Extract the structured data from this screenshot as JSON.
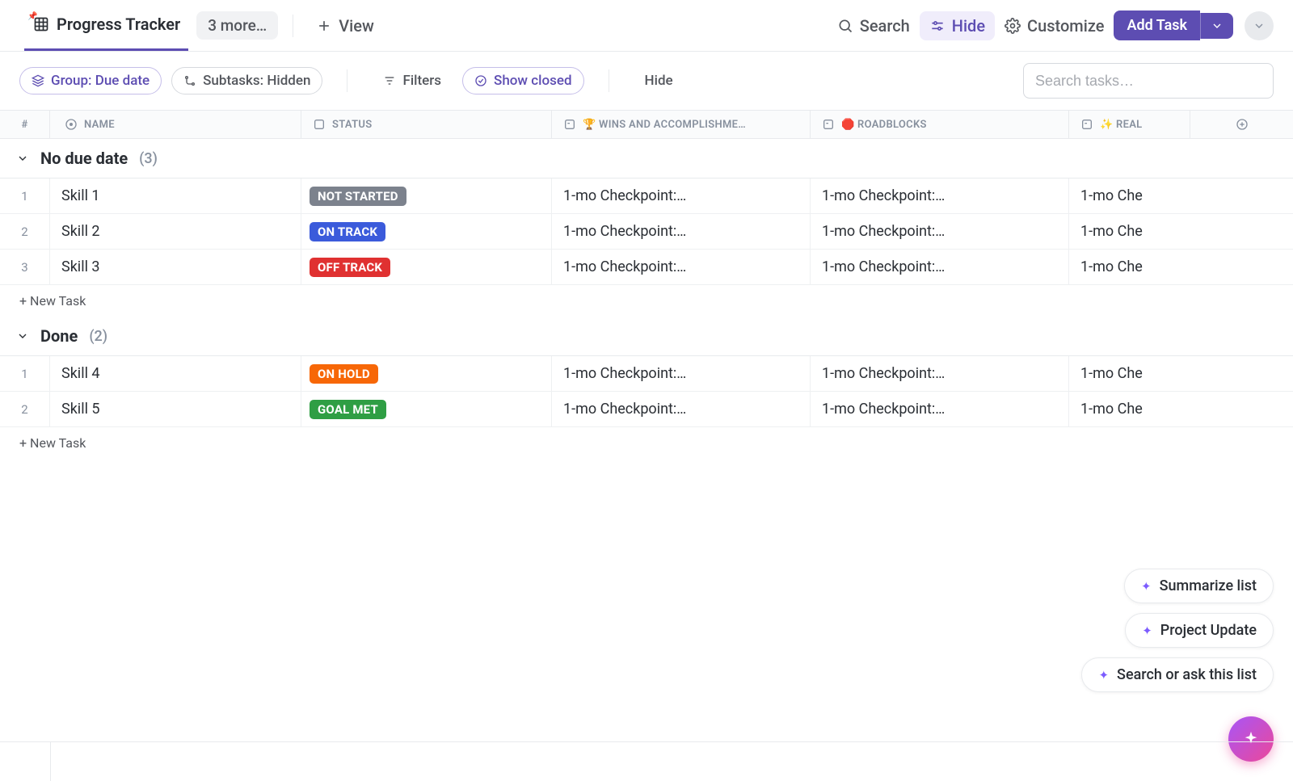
{
  "header": {
    "view_name": "Progress Tracker",
    "more_label": "3 more…",
    "add_view_label": "View",
    "search_label": "Search",
    "hide_label": "Hide",
    "customize_label": "Customize",
    "add_task_label": "Add Task"
  },
  "filters": {
    "group_label": "Group: Due date",
    "subtasks_label": "Subtasks: Hidden",
    "filters_label": "Filters",
    "show_closed_label": "Show closed",
    "hide_label": "Hide",
    "search_placeholder": "Search tasks…"
  },
  "columns": {
    "num": "#",
    "name": "NAME",
    "status": "STATUS",
    "wins": "🏆 WINS AND ACCOMPLISHME…",
    "roadblocks": "🛑 ROADBLOCKS",
    "realizations": "✨ REAL"
  },
  "groups": [
    {
      "title": "No due date",
      "count": "(3)",
      "rows": [
        {
          "idx": "1",
          "name": "Skill 1",
          "status_label": "NOT STARTED",
          "status_class": "b-not",
          "wins": "1-mo Checkpoint:…",
          "roadblocks": "1-mo Checkpoint:…",
          "real": "1-mo Che"
        },
        {
          "idx": "2",
          "name": "Skill 2",
          "status_label": "ON TRACK",
          "status_class": "b-ontrack",
          "wins": "1-mo Checkpoint:…",
          "roadblocks": "1-mo Checkpoint:…",
          "real": "1-mo Che"
        },
        {
          "idx": "3",
          "name": "Skill 3",
          "status_label": "OFF TRACK",
          "status_class": "b-offtrack",
          "wins": "1-mo Checkpoint:…",
          "roadblocks": "1-mo Checkpoint:…",
          "real": "1-mo Che"
        }
      ]
    },
    {
      "title": "Done",
      "count": "(2)",
      "rows": [
        {
          "idx": "1",
          "name": "Skill 4",
          "status_label": "ON HOLD",
          "status_class": "b-hold",
          "wins": "1-mo Checkpoint:…",
          "roadblocks": "1-mo Checkpoint:…",
          "real": "1-mo Che"
        },
        {
          "idx": "2",
          "name": "Skill 5",
          "status_label": "GOAL MET",
          "status_class": "b-goal",
          "wins": "1-mo Checkpoint:…",
          "roadblocks": "1-mo Checkpoint:…",
          "real": "1-mo Che"
        }
      ]
    }
  ],
  "new_task_label": "+ New Task",
  "ai": {
    "summarize": "Summarize list",
    "project": "Project Update",
    "search": "Search or ask this list"
  }
}
